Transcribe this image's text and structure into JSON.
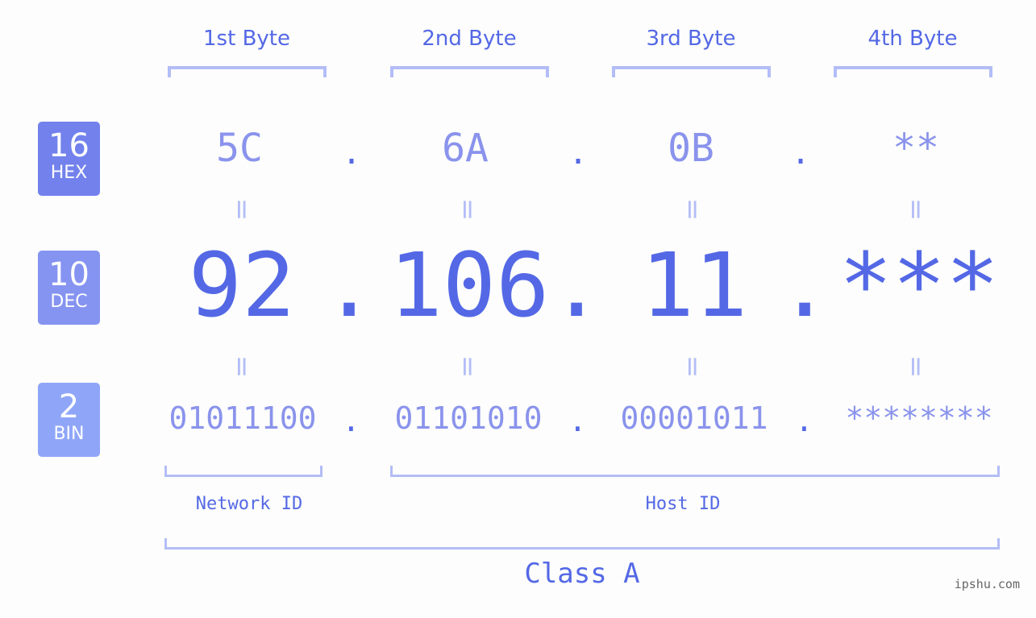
{
  "headers": [
    "1st Byte",
    "2nd Byte",
    "3rd Byte",
    "4th Byte"
  ],
  "badges": [
    {
      "num": "16",
      "label": "HEX",
      "color": "#7281ec"
    },
    {
      "num": "10",
      "label": "DEC",
      "color": "#8593f1"
    },
    {
      "num": "2",
      "label": "BIN",
      "color": "#8fa6f8"
    }
  ],
  "hex": [
    "5C",
    "6A",
    "0B",
    "**"
  ],
  "dec": [
    "92",
    "106",
    "11",
    "***"
  ],
  "bin": [
    "01011100",
    "01101010",
    "00001011",
    "********"
  ],
  "separator": ".",
  "equals": "=",
  "segments": {
    "network": "Network ID",
    "host": "Host ID"
  },
  "class_label": "Class A",
  "watermark": "ipshu.com"
}
